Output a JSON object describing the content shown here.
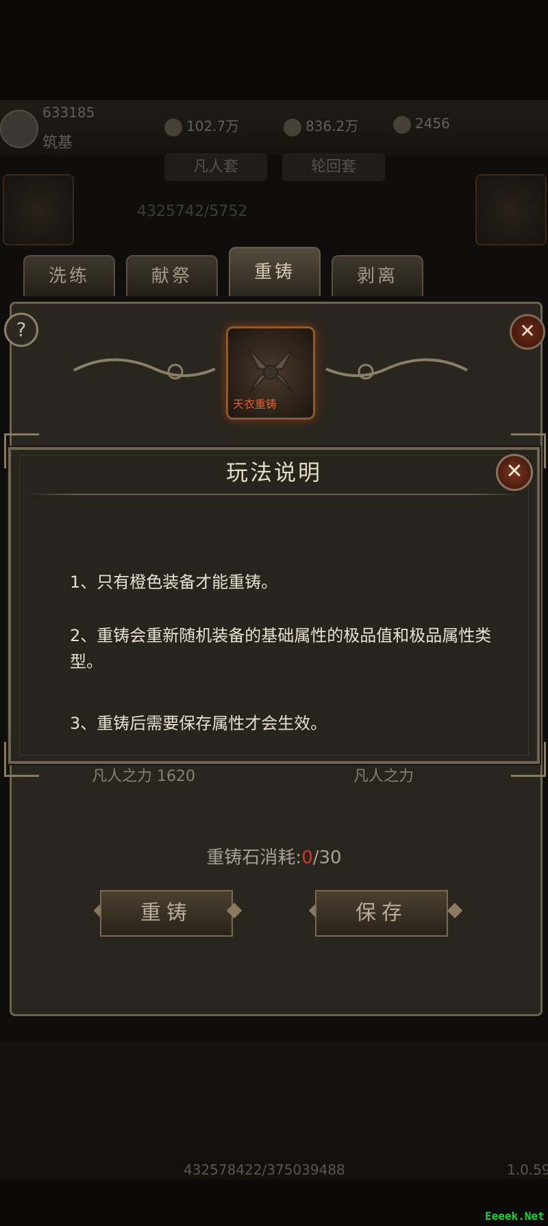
{
  "hud": {
    "player_name": "633185",
    "rank": "筑基",
    "resource_1": "102.7万",
    "resource_2": "836.2万",
    "resource_3": "2456",
    "tab_left": "凡人套",
    "tab_right": "轮回套",
    "hidden_stat": "4325742/5752"
  },
  "tabs": [
    "洗练",
    "献祭",
    "重铸",
    "剥离"
  ],
  "equipment": {
    "label": "天衣重铸"
  },
  "panel": {
    "left_stat": "凡人之力 1620",
    "right_stat": "凡人之力",
    "cost_label": "重铸石消耗:",
    "cost_current": "0",
    "cost_total": "/30",
    "reforge_button": "重铸",
    "save_button": "保存"
  },
  "dialog": {
    "title": "玩法说明",
    "close_label": "✕",
    "rules": [
      "1、只有橙色装备才能重铸。",
      "2、重铸会重新随机装备的基础属性的极品值和极品属性类型。",
      "3、重铸后需要保存属性才会生效。"
    ]
  },
  "footer": {
    "stat": "432578422/375039488",
    "version": "1.0.59"
  },
  "watermark": "Eeeek.Net",
  "colors": {
    "accent_gold": "#c9a86a",
    "cost_zero": "#d03a2a",
    "dialog_bg": "#27231d"
  }
}
